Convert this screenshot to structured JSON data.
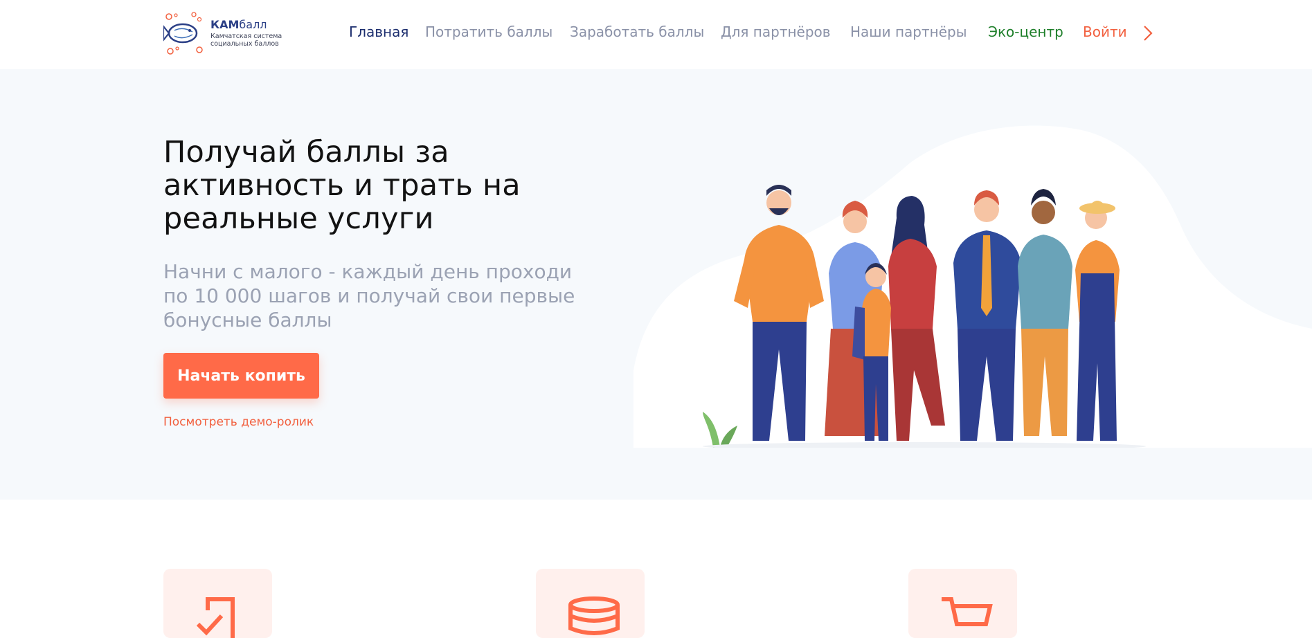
{
  "brand": {
    "name_prefix": "КАМ",
    "name_suffix": "балл",
    "tagline_line1": "Камчатская система",
    "tagline_line2": "социальных баллов"
  },
  "nav": {
    "items": [
      {
        "label": "Главная"
      },
      {
        "label": "Потратить баллы"
      },
      {
        "label": "Заработать баллы"
      },
      {
        "label": "Для партнёров"
      },
      {
        "label": "Наши партнёры"
      },
      {
        "label": "Эко-центр"
      },
      {
        "label": "Войти"
      }
    ]
  },
  "hero": {
    "title": "Получай баллы за активность и трать на реальные услуги",
    "subtitle": "Начни с малого - каждый день проходи по 10 000 шагов и получай свои первые бонусные баллы",
    "cta_label": "Начать копить",
    "demo_link": "Посмотреть демо-ролик"
  },
  "features": [
    {
      "icon": "checklist-icon"
    },
    {
      "icon": "coins-icon"
    },
    {
      "icon": "cart-icon"
    }
  ],
  "colors": {
    "accent": "#ff6a48",
    "nav_active": "#1c2e6e",
    "nav_eco": "#1e7f2a",
    "nav_muted": "#8a91a7",
    "hero_bg": "#f6f9fc"
  }
}
